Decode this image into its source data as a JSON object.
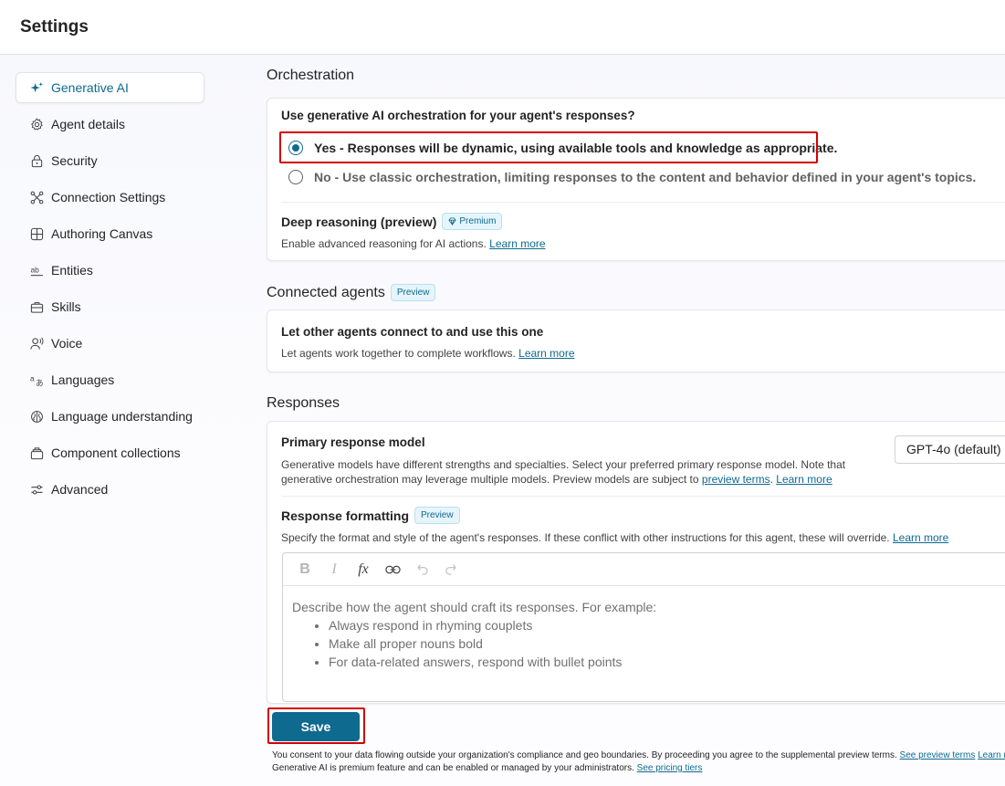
{
  "header": {
    "title": "Settings"
  },
  "sidebar": {
    "items": [
      {
        "label": "Generative AI",
        "icon": "sparkle-icon",
        "active": true
      },
      {
        "label": "Agent details",
        "icon": "gear-icon"
      },
      {
        "label": "Security",
        "icon": "lock-icon"
      },
      {
        "label": "Connection Settings",
        "icon": "connection-icon"
      },
      {
        "label": "Authoring Canvas",
        "icon": "grid-icon"
      },
      {
        "label": "Entities",
        "icon": "entities-icon"
      },
      {
        "label": "Skills",
        "icon": "briefcase-icon"
      },
      {
        "label": "Voice",
        "icon": "voice-icon"
      },
      {
        "label": "Languages",
        "icon": "languages-icon"
      },
      {
        "label": "Language understanding",
        "icon": "brain-icon"
      },
      {
        "label": "Component collections",
        "icon": "collection-icon"
      },
      {
        "label": "Advanced",
        "icon": "sliders-icon"
      }
    ]
  },
  "orchestration": {
    "title": "Orchestration",
    "question": "Use generative AI orchestration for your agent's responses?",
    "option_yes": "Yes - Responses will be dynamic, using available tools and knowledge as appropriate.",
    "option_no": "No - Use classic orchestration, limiting responses to the content and behavior defined in your agent's topics.",
    "selected": "yes",
    "deep_reasoning_label": "Deep reasoning (preview)",
    "deep_reasoning_badge": "Premium",
    "deep_reasoning_desc": "Enable advanced reasoning for AI actions.",
    "learn_more": "Learn more"
  },
  "connected_agents": {
    "title": "Connected agents",
    "badge": "Preview",
    "label": "Let other agents connect to and use this one",
    "desc": "Let agents work together to complete workflows.",
    "learn_more": "Learn more"
  },
  "responses": {
    "title": "Responses",
    "model_label": "Primary response model",
    "model_desc_1": "Generative models have different strengths and specialties. Select your preferred primary response model. Note that",
    "model_desc_2": "generative orchestration may leverage multiple models. Preview models are subject to",
    "preview_terms": "preview terms",
    "learn_more": "Learn more",
    "model_value": "GPT-4o (default)",
    "formatting_label": "Response formatting",
    "formatting_badge": "Preview",
    "formatting_desc": "Specify the format and style of the agent's responses. If these conflict with other instructions for this agent, these will override.",
    "editor_placeholder": "Describe how the agent should craft its responses. For example:",
    "editor_examples": [
      "Always respond in rhyming couplets",
      "Make all proper nouns bold",
      "For data-related answers, respond with bullet points"
    ]
  },
  "footer": {
    "save_label": "Save",
    "consent": "You consent to your data flowing outside your organization's compliance and geo boundaries. By proceeding you agree to the supplemental preview terms.",
    "see_preview_terms": "See preview terms",
    "learn_trunc": "Learn r",
    "premium_note": "Generative AI is premium feature and can be enabled or managed by your administrators.",
    "see_pricing": "See pricing tiers"
  },
  "colors": {
    "accent": "#0e6a8f",
    "highlight": "#d40000"
  }
}
